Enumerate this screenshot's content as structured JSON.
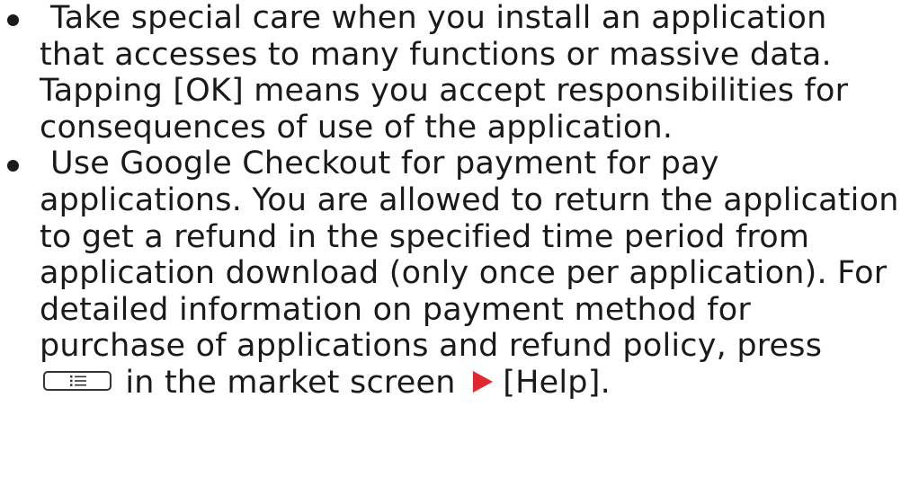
{
  "bullets": [
    {
      "text": "Take special care when you install an application that accesses to many functions or massive data. Tapping [OK] means you accept responsibilities for consequences of use of the application."
    },
    {
      "text_before_key": "Use Google Checkout for payment for pay applications. You are allowed to return the application to get a refund in the specified time period from application download (only once per application). For detailed information on payment method for purchase of applications and refund policy, press",
      "menu_key_icon": "menu-key-icon",
      "text_after_key": "in the market screen",
      "arrow_icon": "red-arrow-icon",
      "text_after_arrow": "[Help]."
    }
  ],
  "colors": {
    "text": "#1a1a1a",
    "arrow": "#e0262e"
  }
}
